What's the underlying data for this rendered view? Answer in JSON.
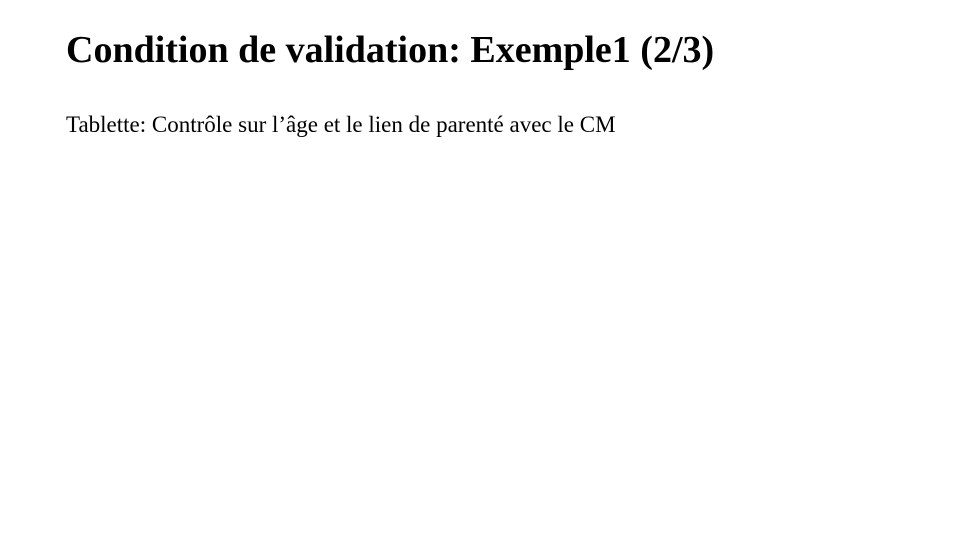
{
  "slide": {
    "title": "Condition de validation: Exemple1 (2/3)",
    "body": "Tablette: Contrôle sur l’âge et le lien de parenté avec le CM"
  }
}
